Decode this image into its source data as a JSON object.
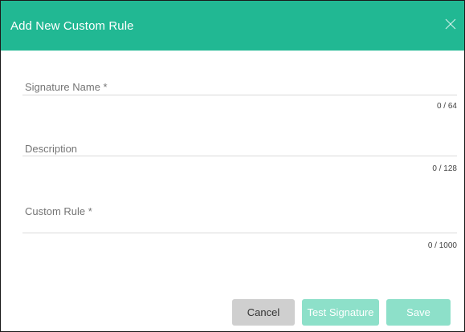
{
  "dialog": {
    "title": "Add New Custom Rule",
    "close_icon": "close-icon"
  },
  "fields": {
    "signature_name": {
      "label": "Signature Name *",
      "value": "",
      "counter": "0 / 64"
    },
    "description": {
      "label": "Description",
      "value": "",
      "counter": "0 / 128"
    },
    "custom_rule": {
      "label": "Custom Rule *",
      "value": "",
      "counter": "0 / 1000"
    }
  },
  "buttons": {
    "cancel": "Cancel",
    "test_signature": "Test Signature",
    "save": "Save"
  },
  "colors": {
    "header": "#21b893",
    "primary_disabled": "#8de0c9",
    "cancel_bg": "#cfcfcf"
  }
}
